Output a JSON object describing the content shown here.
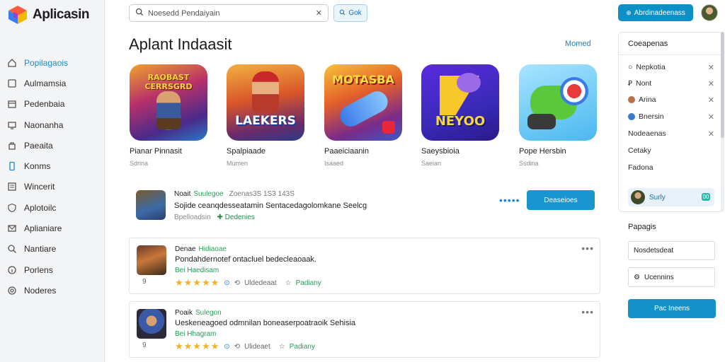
{
  "app": {
    "title": "Aplicasin"
  },
  "sidebar": {
    "items": [
      {
        "label": "Popilagaois",
        "icon": "home-icon",
        "active": true
      },
      {
        "label": "Aulmamsia",
        "icon": "square-icon"
      },
      {
        "label": "Pedenbaia",
        "icon": "calendar-icon"
      },
      {
        "label": "Naonanha",
        "icon": "monitor-icon"
      },
      {
        "label": "Paeaita",
        "icon": "bag-icon"
      },
      {
        "label": "Konms",
        "icon": "phone-icon"
      },
      {
        "label": "Wincerit",
        "icon": "list-icon"
      },
      {
        "label": "Aplotoilc",
        "icon": "shield-icon"
      },
      {
        "label": "Aplianiare",
        "icon": "envelope-icon"
      },
      {
        "label": "Nantiare",
        "icon": "search-icon"
      },
      {
        "label": "Porlens",
        "icon": "info-icon"
      },
      {
        "label": "Noderes",
        "icon": "settings-icon"
      }
    ]
  },
  "search": {
    "placeholder": "Noesedd Pendaiyain",
    "button": "Gok"
  },
  "header": {
    "cta": "Abrdinadeenass"
  },
  "main": {
    "title": "Aplant Indaasit",
    "more": "Momed",
    "apps": [
      {
        "name": "Pianar Pinnasit",
        "sub": "Sdrina",
        "tile_text": "RAOBAST CERRSGRD",
        "theme": "purple"
      },
      {
        "name": "Spalpiaade",
        "sub": "Mumen",
        "tile_text": "LAEKERS",
        "theme": "red"
      },
      {
        "name": "Paaeiciaanin",
        "sub": "Isaaed",
        "tile_text": "MOTASBA",
        "theme": "orange"
      },
      {
        "name": "Saeysbioia",
        "sub": "Saeian",
        "tile_text": "NEYOO",
        "theme": "blue"
      },
      {
        "name": "Pope Hersbin",
        "sub": "Ssdina",
        "tile_text": "",
        "theme": "sky"
      }
    ],
    "featured": {
      "title": "Noait",
      "highlight": "Suulegoe",
      "meta": "Zoenas3S 1S3 143S",
      "description": "Sojide ceanqdesseatamin Sentacedagolomkane Seelcg",
      "footer": "Bpelloadsin",
      "developer": "Dedenies",
      "button": "Deaseioes"
    },
    "reviews": [
      {
        "title": "Denae",
        "highlight": "Hidiaoae",
        "description": "Pondahdernotef ontacluel bedecleaoaak.",
        "tag": "Bei Haedisam",
        "number": "9",
        "rating": 5,
        "stars": "★★★★★",
        "helpful": "Uldedeaat",
        "link": "Padiany"
      },
      {
        "title": "Poaik",
        "highlight": "Sulegon",
        "description": "Ueskeneagoed odmnilan boneaserpoatraoik Sehisia",
        "tag": "Bei Hhagram",
        "number": "9",
        "rating": 5,
        "stars": "★★★★★",
        "helpful": "Ulideaet",
        "link": "Padiany"
      }
    ]
  },
  "right": {
    "panel_title": "Coeapenas",
    "items": [
      {
        "label": "Nepkotia",
        "icon": "circle-icon",
        "removable": true
      },
      {
        "label": "Nont",
        "icon": "note-icon",
        "removable": true
      },
      {
        "label": "Arina",
        "icon": "avatar-icon",
        "removable": true
      },
      {
        "label": "Bnersin",
        "icon": "globe-icon",
        "removable": true
      },
      {
        "label": "Nodeaenas",
        "icon": "",
        "removable": true
      },
      {
        "label": "Cetaky",
        "icon": "",
        "removable": false
      },
      {
        "label": "Fadona",
        "icon": "",
        "removable": false
      }
    ],
    "selected": {
      "label": "Surly",
      "badge": "00"
    },
    "section": "Papagis",
    "field1": "Nosdetsdeat",
    "field2": "Ucennins",
    "save": "Pac Ineens"
  },
  "colors": {
    "accent": "#1292c9",
    "green": "#2aa05a",
    "star": "#f0b323"
  }
}
